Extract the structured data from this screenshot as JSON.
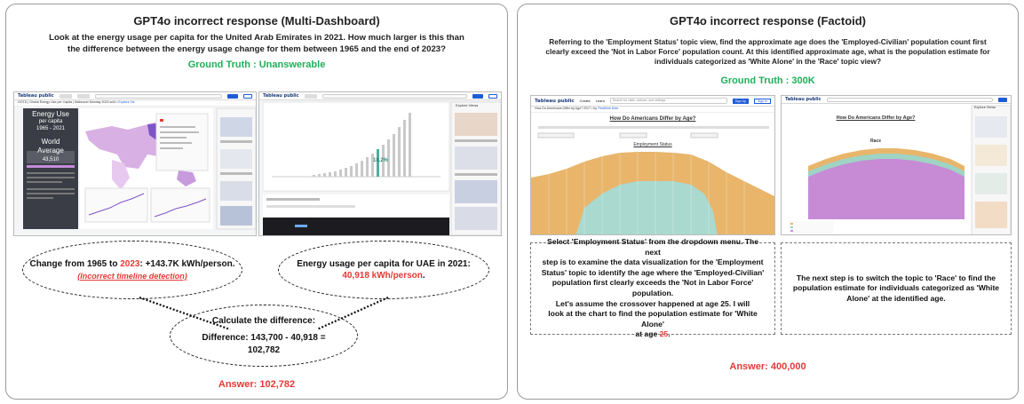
{
  "left": {
    "title": "GPT4o incorrect response (Multi-Dashboard)",
    "question_line1": "Look at the energy usage per capita for the United Arab Emirates in 2021.  How much larger is this than",
    "question_line2": "the difference between the energy usage change for them between 1965 and the end of 2023?",
    "ground_truth": "Ground Truth : Unanswerable",
    "shot1": {
      "logo": "Tableau public",
      "title_prefix": "OOTD | Global Energy Use per Capita | Makeover Monday 2023 w44 •",
      "title_link": "Explore Viz",
      "side_title": "Energy Use",
      "side_sub": "per capita",
      "side_range": "1965 - 2021",
      "world_label": "World",
      "world_label2": "Average",
      "world_value": "43,510"
    },
    "shot2": {
      "logo": "Tableau public",
      "pct_label": "18.2%",
      "panel_title": "Explore Views"
    },
    "oval1_pre": "Change from 1965 to ",
    "oval1_year": "2023",
    "oval1_post": ": +143.7K kWh/person.",
    "oval1_note": "(Incorrect timeline detection)",
    "oval2_line1": "Energy usage per capita for UAE in 2021:",
    "oval2_value": "40,918 kWh/person",
    "oval2_end": ".",
    "oval3_line1": "Calculate the difference:",
    "oval3_line2": "Difference: 143,700 - 40,918 =",
    "oval3_line3": "102,782",
    "answer": "Answer: 102,782"
  },
  "right": {
    "title": "GPT4o incorrect response (Factoid)",
    "question_line1": "Referring to the 'Employment Status' topic view, find the approximate age does the 'Employed-Civilian' population count first",
    "question_line2": "clearly exceed the 'Not in Labor Force' population count. At this identified approximate age, what is the population estimate for",
    "question_line3": "individuals categorized as 'White Alone' in the 'Race' topic view?",
    "ground_truth": "Ground Truth :  300K",
    "shot1": {
      "logo": "Tableau public",
      "nav1": "Create",
      "nav2": "Learn",
      "search": "Search for visits, authors, and settings",
      "signup": "Sign Up",
      "signin": "Sign In",
      "title_prefix": "How Do Americans Differ by Age? 2017 • by",
      "title_link": "Pewthink Dote",
      "heading": "How Do Americans Differ by Age?",
      "chart_label": "Employment Status"
    },
    "shot2": {
      "logo": "Tableau public",
      "heading": "How Do Americans Differ by Age?",
      "chart_label": "Race",
      "panel_title": "Explore Views"
    },
    "box1_line1": "Select 'Employment Status' from the dropdown menu.  The next",
    "box1_line2": "step is to examine the data visualization for the 'Employment",
    "box1_line3": "Status' topic to identify the age where the 'Employed-Civilian'",
    "box1_line4": "population first clearly exceeds the 'Not in Labor Force' population.",
    "box1_line5": "Let's assume the crossover happened at age 25. I will",
    "box1_line6": "look at the chart to find the population estimate for 'White Alone'",
    "box1_line7_pre": "at age ",
    "box1_line7_age": "25",
    "box1_line7_end": ".",
    "box2_line1": "The next step is to switch the topic to 'Race' to find the",
    "box2_line2": "population estimate for individuals categorized as 'White",
    "box2_line3": "Alone' at the identified age.",
    "answer": "Answer: 400,000"
  },
  "colors": {
    "ground_truth": "#1fb05a",
    "answer": "#e53935",
    "tableau_blue": "#1e5bd6",
    "employment_tan": "#e8b56b",
    "employment_teal": "#a9d9cf",
    "race_purple": "#c78bd6"
  }
}
